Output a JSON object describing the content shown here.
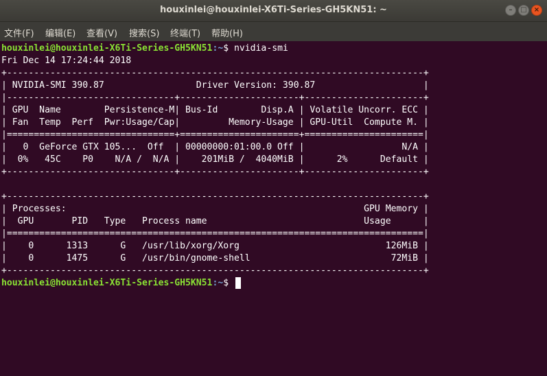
{
  "window": {
    "title": "houxinlei@houxinlei-X6Ti-Series-GH5KN51: ~"
  },
  "menu": {
    "items": [
      {
        "label": "文件(F)"
      },
      {
        "label": "编辑(E)"
      },
      {
        "label": "查看(V)"
      },
      {
        "label": "搜索(S)"
      },
      {
        "label": "终端(T)"
      },
      {
        "label": "帮助(H)"
      }
    ]
  },
  "colors": {
    "background": "#300a24",
    "prompt_user": "#8ae234",
    "prompt_path": "#729fcf",
    "text": "#ffffff"
  },
  "terminal": {
    "prompt1": {
      "user": "houxinlei@houxinlei-X6Ti-Series-GH5KN51",
      "path": ":~",
      "symbol": "$ ",
      "command": "nvidia-smi"
    },
    "output": [
      "Fri Dec 14 17:24:44 2018",
      "+-----------------------------------------------------------------------------+",
      "| NVIDIA-SMI 390.87                 Driver Version: 390.87                    |",
      "|-------------------------------+----------------------+----------------------+",
      "| GPU  Name        Persistence-M| Bus-Id        Disp.A | Volatile Uncorr. ECC |",
      "| Fan  Temp  Perf  Pwr:Usage/Cap|         Memory-Usage | GPU-Util  Compute M. |",
      "|===============================+======================+======================|",
      "|   0  GeForce GTX 105...  Off  | 00000000:01:00.0 Off |                  N/A |",
      "|  0%   45C    P0    N/A /  N/A |    201MiB /  4040MiB |      2%      Default |",
      "+-------------------------------+----------------------+----------------------+",
      "",
      "+-----------------------------------------------------------------------------+",
      "| Processes:                                                       GPU Memory |",
      "|  GPU       PID   Type   Process name                             Usage      |",
      "|=============================================================================|",
      "|    0      1313      G   /usr/lib/xorg/Xorg                           126MiB |",
      "|    0      1475      G   /usr/bin/gnome-shell                          72MiB |",
      "+-----------------------------------------------------------------------------+"
    ],
    "prompt2": {
      "user": "houxinlei@houxinlei-X6Ti-Series-GH5KN51",
      "path": ":~",
      "symbol": "$ "
    }
  }
}
